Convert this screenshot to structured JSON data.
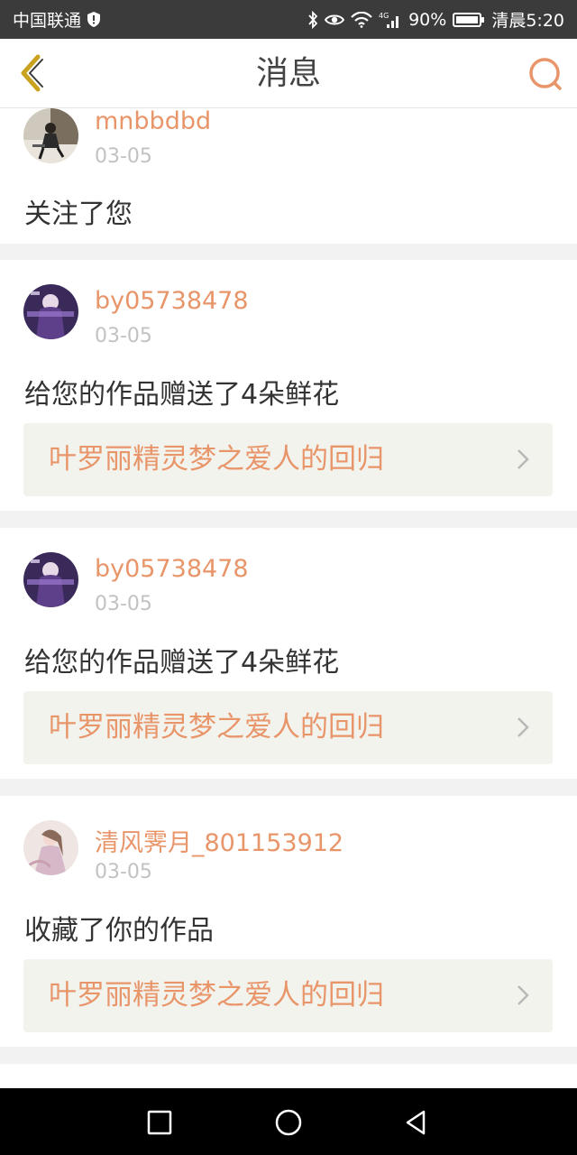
{
  "status_bar": {
    "carrier": "中国联通",
    "network": "4G",
    "battery": "90%",
    "time": "清晨5:20",
    "icons": [
      "shield-alert-icon",
      "bluetooth-icon",
      "eye-icon",
      "wifi-icon",
      "signal-icon",
      "battery-icon"
    ]
  },
  "header": {
    "title": "消息",
    "back_icon": "chevron-left-icon",
    "search_icon": "search-icon",
    "accent_color": "#e8956a",
    "back_color": "#c9a21f"
  },
  "messages": [
    {
      "username": "mnbbdbd",
      "date": "03-05",
      "action": "关注了您"
    },
    {
      "username": "by05738478",
      "date": "03-05",
      "action": "给您的作品赠送了4朵鲜花",
      "work_title": "叶罗丽精灵梦之爱人的回归"
    },
    {
      "username": "by05738478",
      "date": "03-05",
      "action": "给您的作品赠送了4朵鲜花",
      "work_title": "叶罗丽精灵梦之爱人的回归"
    },
    {
      "username": "清风霁月_801153912",
      "date": "03-05",
      "action": "收藏了你的作品",
      "work_title": "叶罗丽精灵梦之爱人的回归"
    }
  ],
  "nav_bar": {
    "icons": [
      "recents-square-icon",
      "home-circle-icon",
      "back-triangle-icon"
    ]
  }
}
